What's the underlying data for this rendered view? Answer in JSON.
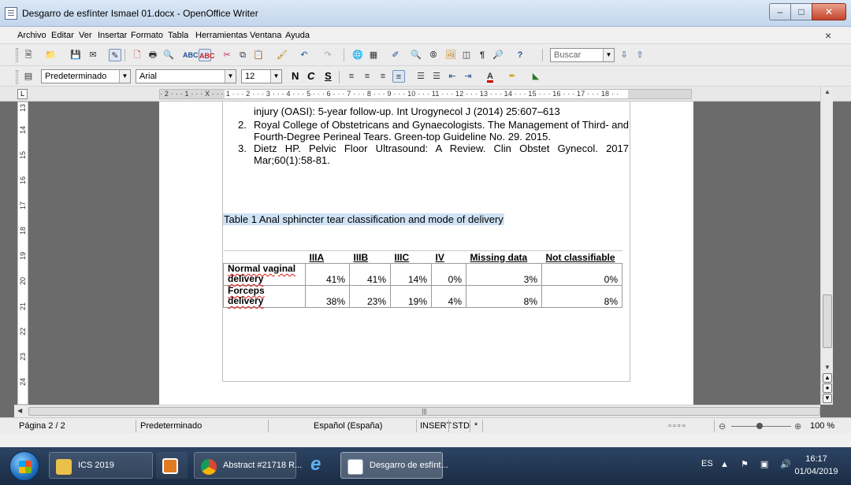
{
  "window": {
    "title": "Desgarro de esfínter Ismael 01.docx - OpenOffice Writer"
  },
  "menu": {
    "items": [
      "Archivo",
      "Editar",
      "Ver",
      "Insertar",
      "Formato",
      "Tabla",
      "Herramientas",
      "Ventana",
      "Ayuda"
    ]
  },
  "toolbar": {
    "search_placeholder": "Buscar",
    "style_value": "Predeterminado",
    "font_value": "Arial",
    "size_value": "12",
    "bold_label": "N",
    "italic_label": "C",
    "underline_label": "S"
  },
  "ruler": {
    "ticks": "· 2 · · · 1 · · · X · · · 1 · · · 2 · · · 3 · · · 4 · · · 5 · · · 6 · · · 7 · · · 8 · · · 9 · · · 10 · · · 11 · · · 12 · · · 13 · · · 14 · · · 15 · · · 16 · · · 17 · · · 18 · ·",
    "vticks": [
      "13",
      "14",
      "15",
      "16",
      "17",
      "18",
      "19",
      "20",
      "21",
      "22",
      "23",
      "24"
    ]
  },
  "document": {
    "ref1_tail": "injury (OASI): 5-year follow-up. Int Urogynecol J (2014) 25:607–613",
    "ref2_num": "2.",
    "ref2_text": "Royal College of Obstetricans and Gynaecologists. The Management of Third- and Fourth-Degree Perineal Tears. Green-top Guideline No. 29. 2015.",
    "ref3_num": "3.",
    "ref3_text": "Dietz HP. Pelvic Floor Ultrasound: A Review. Clin Obstet Gynecol. 2017 Mar;60(1):58-81.",
    "table_caption": "Table 1 Anal sphincter tear classification and mode of delivery",
    "table": {
      "headers": [
        "",
        "IIIA",
        "IIIB",
        "IIIC",
        "IV",
        "Missing data",
        "Not classifiable"
      ],
      "rows": [
        {
          "label": "Normal vaginal delivery",
          "cells": [
            "41%",
            "41%",
            "14%",
            "0%",
            "3%",
            "0%"
          ]
        },
        {
          "label": "Forceps delivery",
          "cells": [
            "38%",
            "23%",
            "19%",
            "4%",
            "8%",
            "8%"
          ]
        }
      ]
    }
  },
  "statusbar": {
    "page": "Página 2 / 2",
    "style": "Predeterminado",
    "language": "Español (España)",
    "insert": "INSERT",
    "std": "STD",
    "star": "*",
    "zoom": "100 %"
  },
  "taskbar": {
    "ics_label": "ICS 2019",
    "chrome_label": "Abstract #21718 R...",
    "writer_label": "Desgarro de esfínt...",
    "lang": "ES",
    "time": "16:17",
    "date": "01/04/2019"
  }
}
